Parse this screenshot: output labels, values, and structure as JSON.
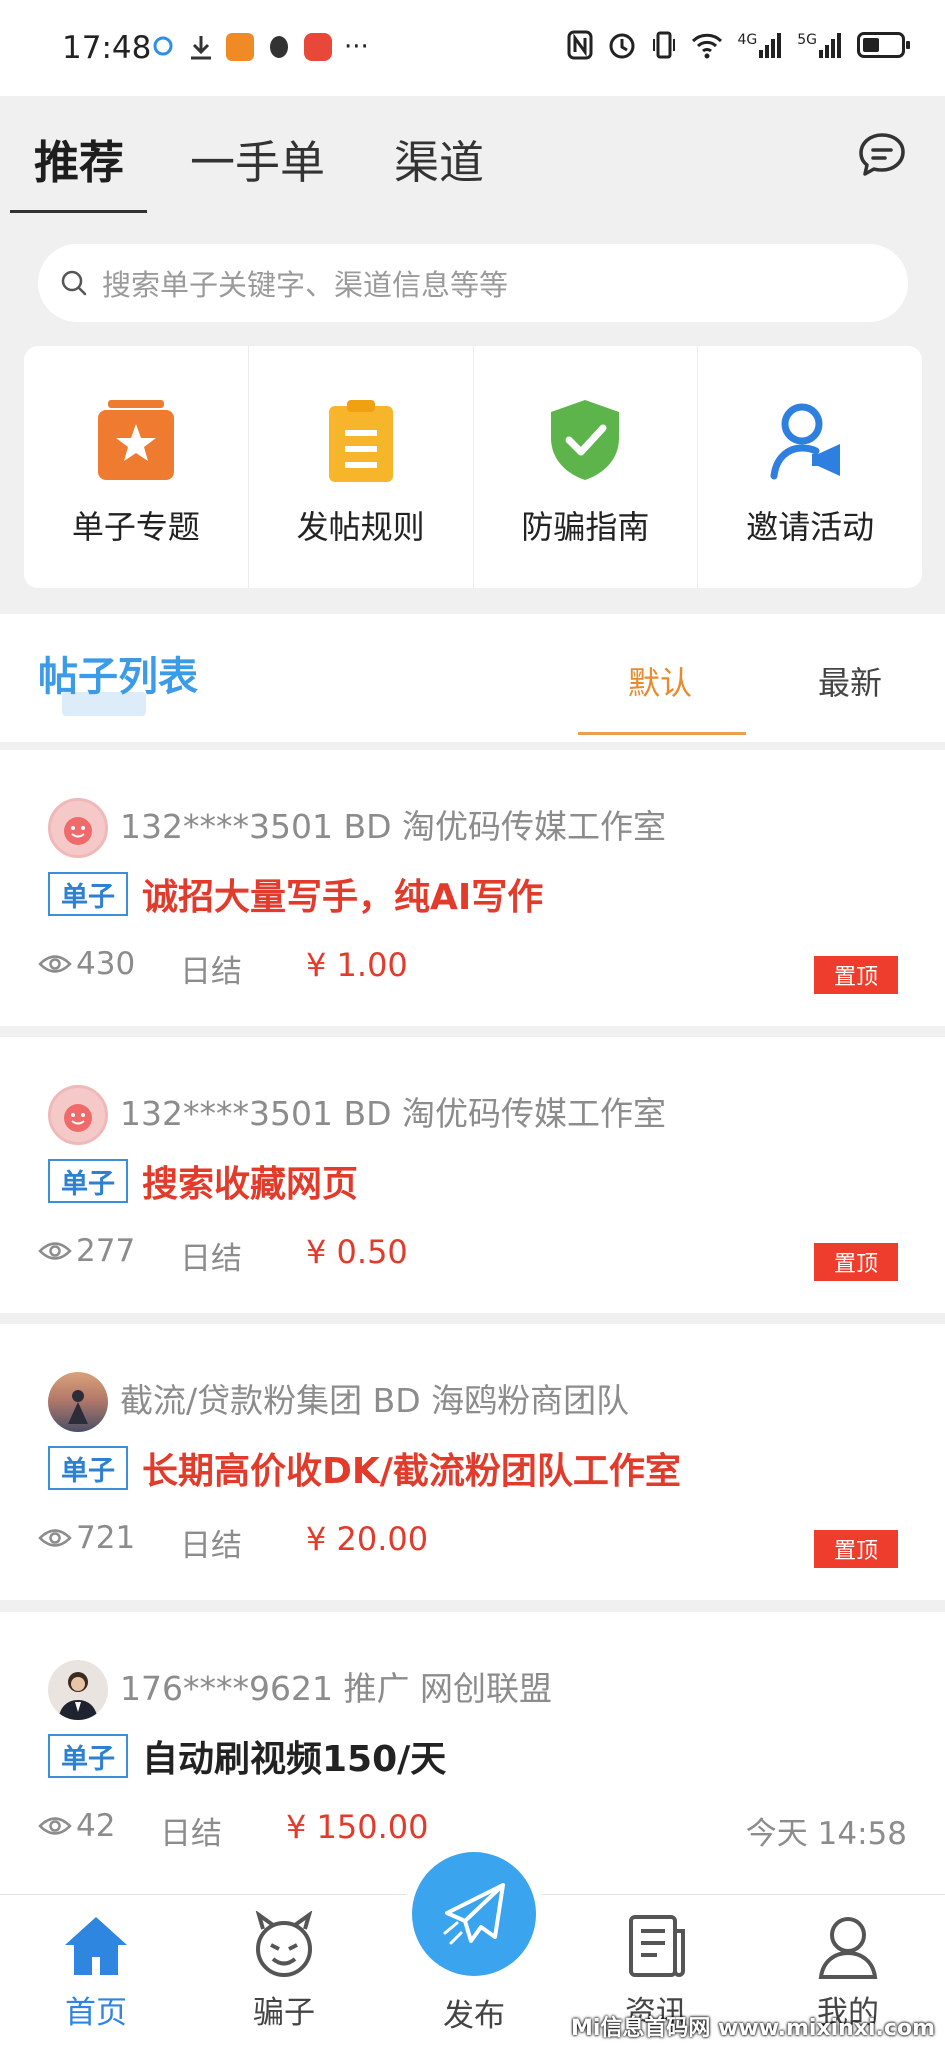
{
  "status_bar": {
    "time": "17:48",
    "more": "···",
    "net4g": "4G",
    "net5g": "5G"
  },
  "top_tabs": [
    {
      "label": "推荐"
    },
    {
      "label": "一手单"
    },
    {
      "label": "渠道"
    }
  ],
  "search": {
    "placeholder": "搜索单子关键字、渠道信息等等"
  },
  "quick_menu": [
    {
      "label": "单子专题",
      "icon": "star-box-icon",
      "color": "#ee7b2f"
    },
    {
      "label": "发帖规则",
      "icon": "clipboard-icon",
      "color": "#f6b52a"
    },
    {
      "label": "防骗指南",
      "icon": "shield-check-icon",
      "color": "#5db44b"
    },
    {
      "label": "邀请活动",
      "icon": "user-megaphone-icon",
      "color": "#2f7fe0"
    }
  ],
  "list": {
    "title": "帖子列表",
    "sort_default": "默认",
    "sort_latest": "最新"
  },
  "posts": [
    {
      "meta": "132****3501 BD 淘优码传媒工作室",
      "tag": "单子",
      "title": "诚招大量写手，纯AI写作",
      "views": "430",
      "settle": "日结",
      "price": "¥ 1.00",
      "pin": "置顶"
    },
    {
      "meta": "132****3501 BD 淘优码传媒工作室",
      "tag": "单子",
      "title": "搜索收藏网页",
      "views": "277",
      "settle": "日结",
      "price": "¥ 0.50",
      "pin": "置顶"
    },
    {
      "meta": "截流/贷款粉集团 BD 海鸥粉商团队",
      "tag": "单子",
      "title": "长期高价收DK/截流粉团队工作室",
      "views": "721",
      "settle": "日结",
      "price": "¥ 20.00",
      "pin": "置顶"
    },
    {
      "meta": "176****9621 推广 网创联盟",
      "tag": "单子",
      "title": "自动刷视频150/天",
      "views": "42",
      "settle": "日结",
      "price": "¥ 150.00",
      "time": "今天 14:58"
    }
  ],
  "bottom_nav": [
    {
      "label": "首页"
    },
    {
      "label": "骗子"
    },
    {
      "label": "发布"
    },
    {
      "label": "资讯"
    },
    {
      "label": "我的"
    }
  ],
  "watermark": "Mi信息首码网 www.mixinxi.com",
  "colors": {
    "accent": "#2f86e0",
    "price_red": "#e23b2b",
    "pin_red": "#ee3d2c",
    "sort_orange": "#e88a2e"
  }
}
